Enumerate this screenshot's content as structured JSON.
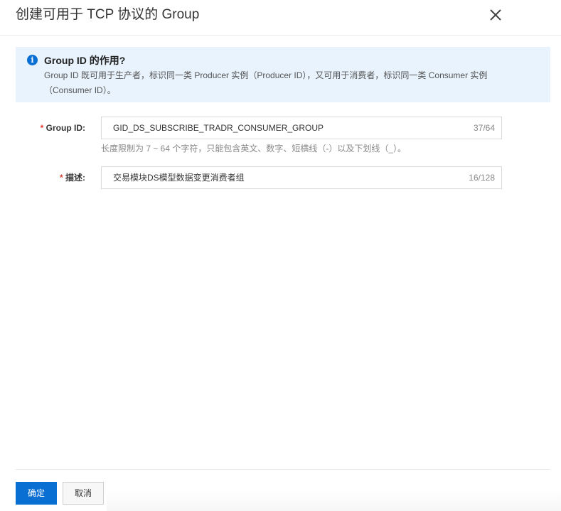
{
  "dialog": {
    "title": "创建可用于 TCP 协议的 Group",
    "close_icon": "close-icon"
  },
  "notice": {
    "icon": "info-icon",
    "title": "Group ID 的作用?",
    "body": "Group ID 既可用于生产者，标识同一类 Producer 实例（Producer ID），又可用于消费者，标识同一类 Consumer 实例（Consumer ID）。"
  },
  "form": {
    "group_id": {
      "required_mark": "*",
      "label": "Group ID:",
      "value": "GID_DS_SUBSCRIBE_TRADR_CONSUMER_GROUP",
      "count": "37/64",
      "hint": "长度限制为 7 ~ 64 个字符，只能包含英文、数字、短横线（-）以及下划线（_）。"
    },
    "description": {
      "required_mark": "*",
      "label": "描述:",
      "value": "交易模块DS模型数据变更消费者组",
      "count": "16/128"
    }
  },
  "footer": {
    "ok_label": "确定",
    "cancel_label": "取消"
  },
  "colors": {
    "primary": "#0a6fd3",
    "notice_bg": "#e8f3fd",
    "required": "#e0392d"
  }
}
